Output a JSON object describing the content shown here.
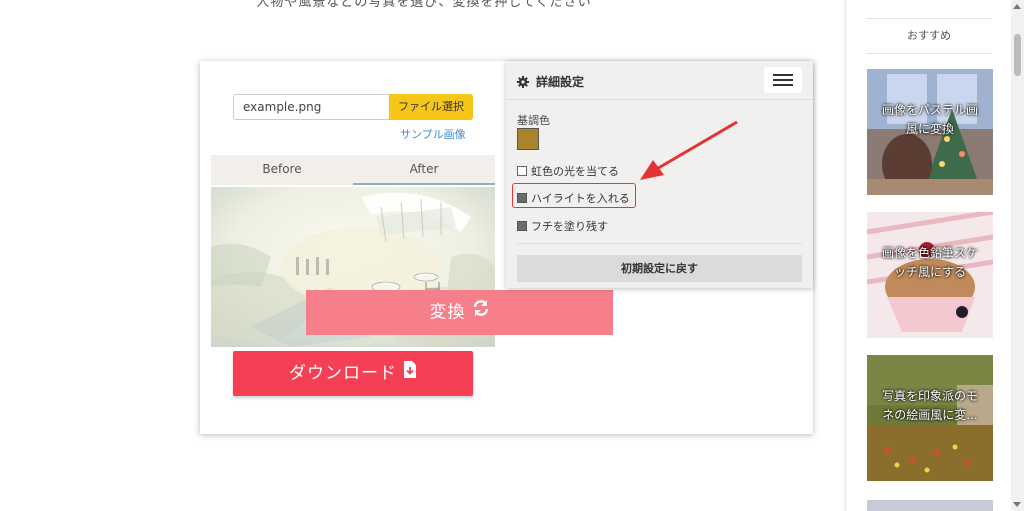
{
  "header": {
    "instruction": "人物や風景などの写真を選び、変換を押してください"
  },
  "upload": {
    "filename": "example.png",
    "choose_button": "ファイル選択",
    "sample_link": "サンプル画像"
  },
  "tabs": {
    "before": "Before",
    "after": "After"
  },
  "actions": {
    "download": "ダウンロード",
    "convert": "変換"
  },
  "settings": {
    "title": "詳細設定",
    "base_color_label": "基調色",
    "base_color": "#a8842a",
    "options": [
      {
        "label": "虹色の光を当てる",
        "checked": false
      },
      {
        "label": "ハイライトを入れる",
        "checked": true
      },
      {
        "label": "フチを塗り残す",
        "checked": true
      }
    ],
    "reset_button": "初期設定に戻す"
  },
  "sidebar": {
    "heading": "おすすめ",
    "items": [
      {
        "label": "画像をパステル画風に変換"
      },
      {
        "label": "画像を色鉛筆スケッチ風にする"
      },
      {
        "label": "写真を印象派のモネの絵画風に変..."
      }
    ]
  },
  "colors": {
    "download": "#f43f55",
    "convert": "#f77f8b",
    "file_button": "#f5c518",
    "link": "#3b8fd6",
    "annotation": "#e33333"
  }
}
